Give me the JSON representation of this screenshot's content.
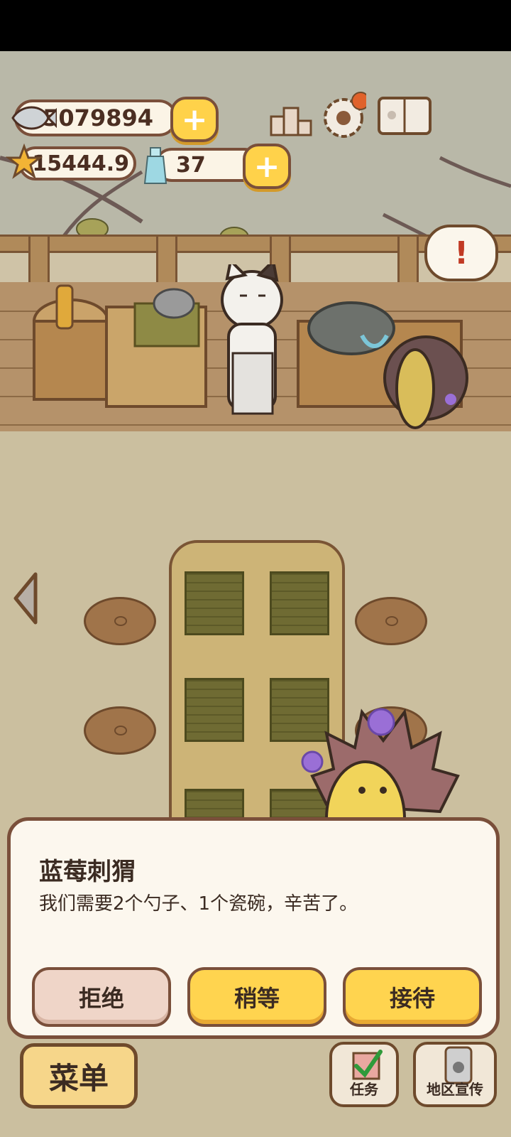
{
  "currencies": {
    "fish": "5079894",
    "stars": "15444.9",
    "bottles": "37"
  },
  "dialog": {
    "npc_name": "蓝莓刺猬",
    "message": "我们需要2个勺子、1个瓷碗，辛苦了。",
    "buttons": {
      "refuse": "拒绝",
      "wait": "稍等",
      "serve": "接待"
    }
  },
  "bottom_bar": {
    "menu_label": "菜单",
    "tasks_label": "任务",
    "promotion_label": "地区宣传"
  },
  "alert_mark": "!",
  "colors": {
    "accent_yellow": "#ffd44f",
    "outline_brown": "#7a4f3a",
    "panel_cream": "#fcf7ee",
    "refuse_pink": "#efd5c8"
  }
}
